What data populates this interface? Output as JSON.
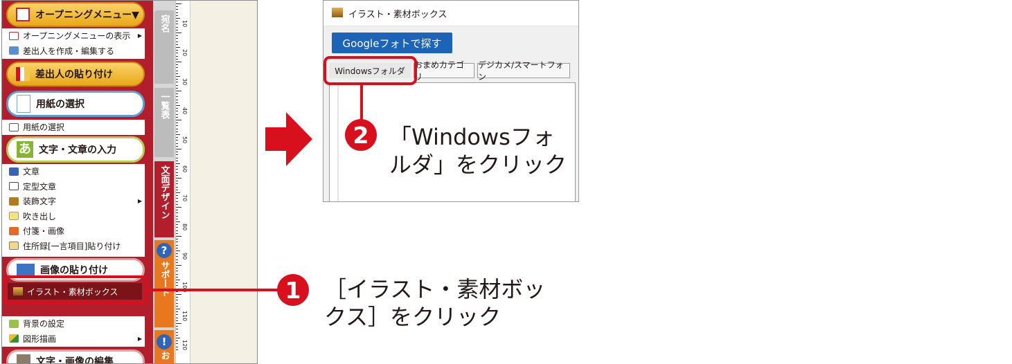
{
  "app_menu": {
    "opening_menu": "オープニングメニュー▼",
    "opening_items": [
      {
        "label": "オープニングメニューの表示",
        "icon": "menu-window-icon",
        "submenu": true
      },
      {
        "label": "差出人を作成・編集する",
        "icon": "card-edit-icon",
        "submenu": false
      }
    ],
    "sender_paste": "差出人の貼り付け",
    "paper_select_header": "用紙の選択",
    "paper_items": [
      {
        "label": "用紙の選択",
        "icon": "paper-icon",
        "submenu": false
      }
    ],
    "text_input_header": "文字・文章の入力",
    "text_input_badge": "あ",
    "text_items": [
      {
        "label": "文章",
        "icon": "hiragana-a-icon",
        "submenu": false
      },
      {
        "label": "定型文章",
        "icon": "template-icon",
        "submenu": false
      },
      {
        "label": "装飾文字",
        "icon": "decor-text-icon",
        "submenu": true
      },
      {
        "label": "吹き出し",
        "icon": "balloon-icon",
        "submenu": false
      },
      {
        "label": "付箋・画像",
        "icon": "sticky-icon",
        "submenu": false
      },
      {
        "label": "住所録[一言項目]貼り付け",
        "icon": "address-icon",
        "submenu": false
      }
    ],
    "image_paste_header": "画像の貼り付け",
    "selected_item": "イラスト・素材ボックス",
    "bottom_items": [
      {
        "label": "背景の設定",
        "icon": "background-icon",
        "submenu": false
      },
      {
        "label": "図形描画",
        "icon": "shape-icon",
        "submenu": true
      }
    ],
    "cut_header": "文字・画像の編集"
  },
  "side_tabs": {
    "tab1": "宛名",
    "tab2": "一覧表",
    "tab3": "文面デザイン",
    "tab4": "サポート",
    "tab5": "お"
  },
  "ruler_ticks": [
    "10",
    "20",
    "30",
    "40",
    "50",
    "60",
    "70",
    "80",
    "90",
    "100",
    "110",
    "120"
  ],
  "dialog": {
    "title": "イラスト・素材ボックス",
    "google_button": "Googleフォトで探す",
    "tabs": [
      "Windowsフォルダ",
      "おまめカテゴリ",
      "デジカメ/スマートフォン"
    ]
  },
  "annotations": {
    "step1_number": "1",
    "step1_line1": "［イラスト・素材ボッ",
    "step1_line2": "クス］をクリック",
    "step2_number": "2",
    "step2_line1": "「Windowsフォ",
    "step2_line2": "ルダ」をクリック"
  },
  "colors": {
    "accent_red": "#d8101d",
    "menu_red": "#b21e2c",
    "google_blue": "#1d63b8"
  }
}
